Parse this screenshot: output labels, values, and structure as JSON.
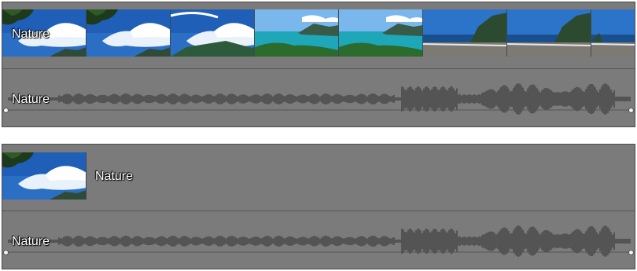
{
  "tracks": [
    {
      "video_label": "Nature",
      "audio_label": "Nature",
      "thumbnails": [
        "sky-tree",
        "sky-tree",
        "sky-hills",
        "lagoon",
        "lagoon",
        "beach-cliff",
        "beach-cliff",
        "beach-cliff-cut"
      ]
    },
    {
      "video_label": "Nature",
      "audio_label": "Nature",
      "thumbnails": [
        "sky-tree"
      ]
    }
  ],
  "colors": {
    "track_bg": "#7b7b7b",
    "waveform": "#4a4a4a",
    "label_text": "#ffffff"
  }
}
